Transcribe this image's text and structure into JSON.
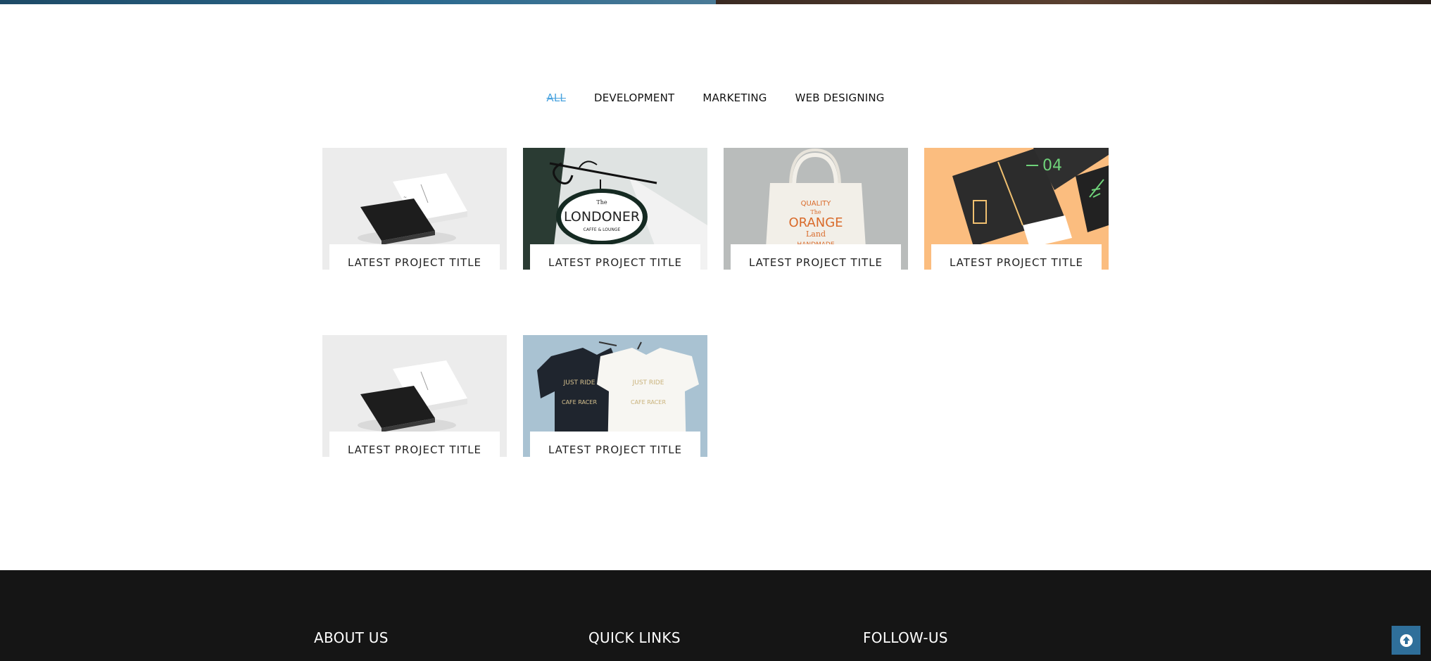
{
  "filters": [
    "ALL",
    "DEVELOPMENT",
    "MARKETING",
    "WEB DESIGNING"
  ],
  "active_filter": "ALL",
  "projects": [
    {
      "title": "LATEST PROJECT TITLE",
      "image": "business-cards"
    },
    {
      "title": "LATEST PROJECT TITLE",
      "image": "londoner-sign"
    },
    {
      "title": "LATEST PROJECT TITLE",
      "image": "orange-tote-bag"
    },
    {
      "title": "LATEST PROJECT TITLE",
      "image": "notebook-04"
    },
    {
      "title": "LATEST PROJECT TITLE",
      "image": "business-cards"
    },
    {
      "title": "LATEST PROJECT TITLE",
      "image": "tshirts"
    }
  ],
  "thumb_text": {
    "sign_the": "The",
    "sign_name": "LONDONER",
    "sign_sub": "CAFFE & LOUNGE",
    "bag_1": "QUALITY",
    "bag_2": "The",
    "bag_3": "ORANGE",
    "bag_4": "Land",
    "bag_5": "HANDMADE",
    "notebook_num": "04",
    "shirt_1": "JUST RIDE",
    "shirt_2": "CAFE RACER"
  },
  "footer": {
    "about": "ABOUT US",
    "links": "QUICK LINKS",
    "follow": "FOLLOW-US"
  },
  "colors": {
    "accent": "#4aa3df",
    "footer_bg": "#151515",
    "scroll_btn": "#2f6f9a"
  },
  "icons": {
    "scroll_top": "arrow-up-circle-icon"
  }
}
